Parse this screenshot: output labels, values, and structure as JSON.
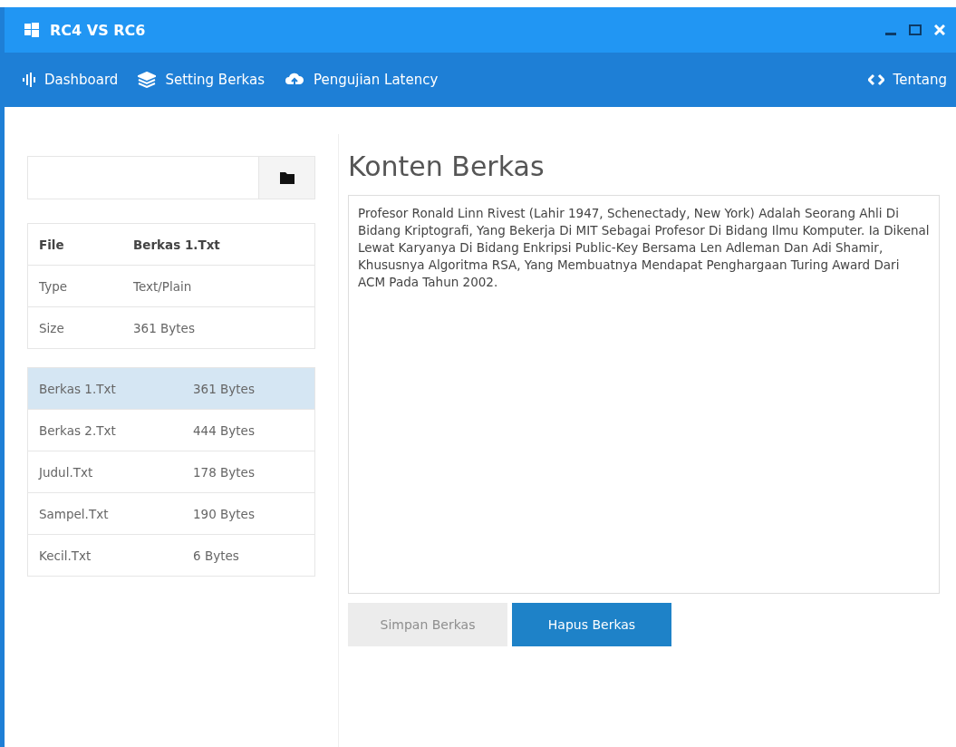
{
  "window": {
    "title": "RC4 VS RC6"
  },
  "nav": [
    {
      "label": "Dashboard"
    },
    {
      "label": "Setting Berkas"
    },
    {
      "label": "Pengujian Latency"
    },
    {
      "label": "Tentang"
    }
  ],
  "file_info": [
    {
      "label": "File",
      "value": "Berkas 1.Txt",
      "kind": "header"
    },
    {
      "label": "Type",
      "value": "Text/Plain",
      "kind": "row"
    },
    {
      "label": "Size",
      "value": "361 Bytes",
      "kind": "row"
    }
  ],
  "files": [
    {
      "name": "Berkas 1.Txt",
      "size": "361 Bytes",
      "selected": true
    },
    {
      "name": "Berkas 2.Txt",
      "size": "444 Bytes",
      "selected": false
    },
    {
      "name": "Judul.Txt",
      "size": "178 Bytes",
      "selected": false
    },
    {
      "name": "Sampel.Txt",
      "size": "190 Bytes",
      "selected": false
    },
    {
      "name": "Kecil.Txt",
      "size": "6 Bytes",
      "selected": false
    }
  ],
  "content": {
    "title": "Konten Berkas",
    "text": "Profesor Ronald Linn Rivest (Lahir 1947, Schenectady, New York) Adalah Seorang Ahli Di Bidang Kriptografi, Yang Bekerja Di MIT Sebagai Profesor Di Bidang Ilmu Komputer. Ia Dikenal Lewat Karyanya Di Bidang Enkripsi Public-Key Bersama Len Adleman Dan Adi Shamir, Khususnya Algoritma RSA, Yang Membuatnya Mendapat Penghargaan Turing Award Dari ACM Pada Tahun 2002."
  },
  "buttons": [
    {
      "label": "Simpan Berkas",
      "disabled": true
    },
    {
      "label": "Hapus Berkas",
      "disabled": false
    }
  ]
}
